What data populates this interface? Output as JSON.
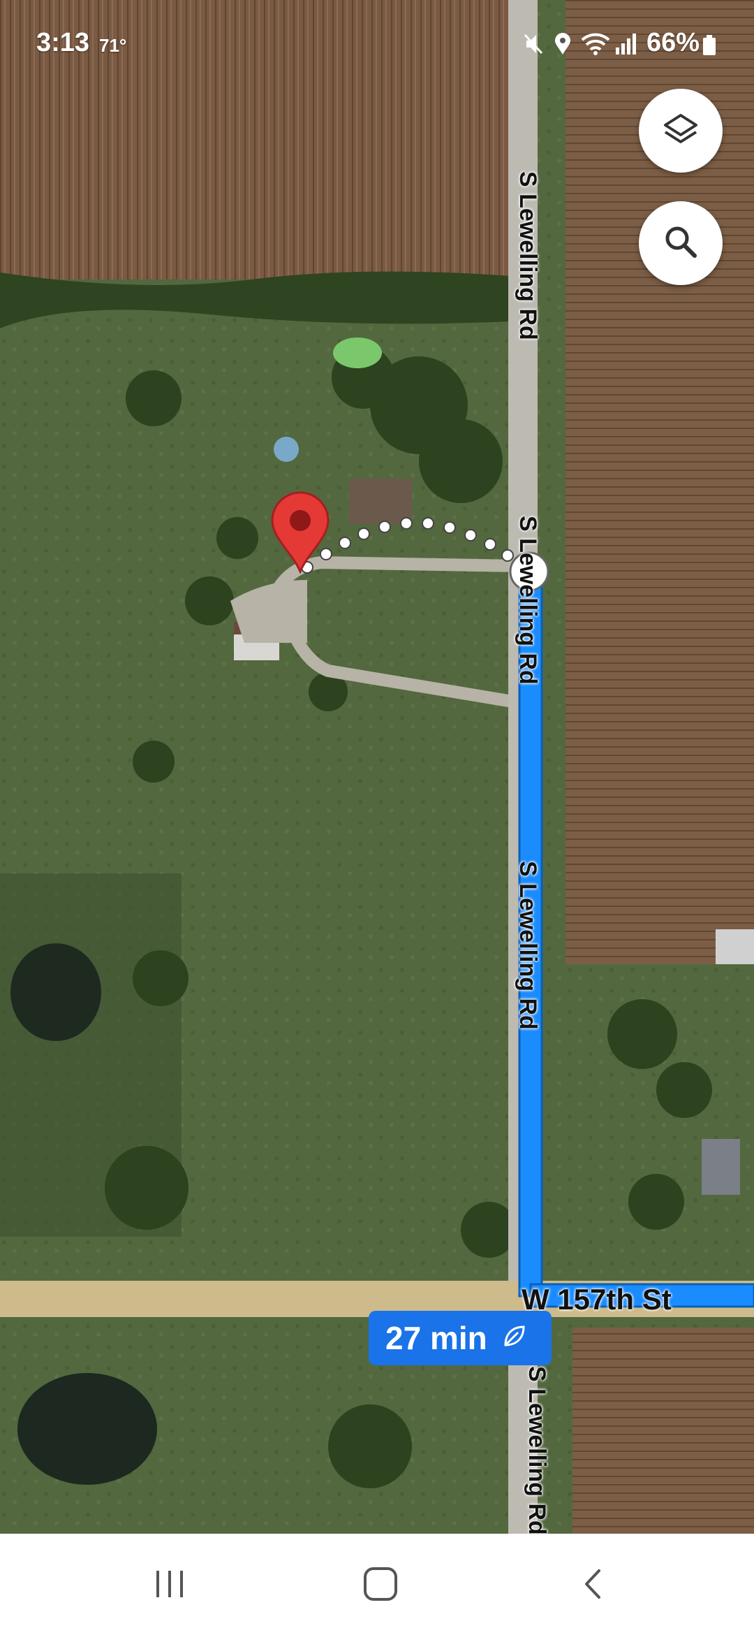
{
  "status_bar": {
    "time": "3:13",
    "temperature": "71°",
    "battery": "66%",
    "icons": [
      "mute-icon",
      "location-icon",
      "wifi-icon",
      "signal-icon",
      "battery-icon"
    ]
  },
  "map": {
    "type": "satellite",
    "streets": {
      "road_label_1": "S Lewelling Rd",
      "road_label_2": "S Lewelling Rd",
      "road_label_3": "S Lewelling Rd",
      "road_label_4": "S Lewelling Rd",
      "cross_street": "W 157th St"
    },
    "route_color": "#1a8cff",
    "marker_color": "#e53935"
  },
  "buttons": {
    "layers": "layers-icon",
    "search": "search-icon"
  },
  "eta": {
    "label": "27 min",
    "icon": "eco-leaf-icon",
    "color": "#1a73e8"
  },
  "nav": {
    "recent": "recent-apps-icon",
    "home": "home-icon",
    "back": "back-icon"
  }
}
